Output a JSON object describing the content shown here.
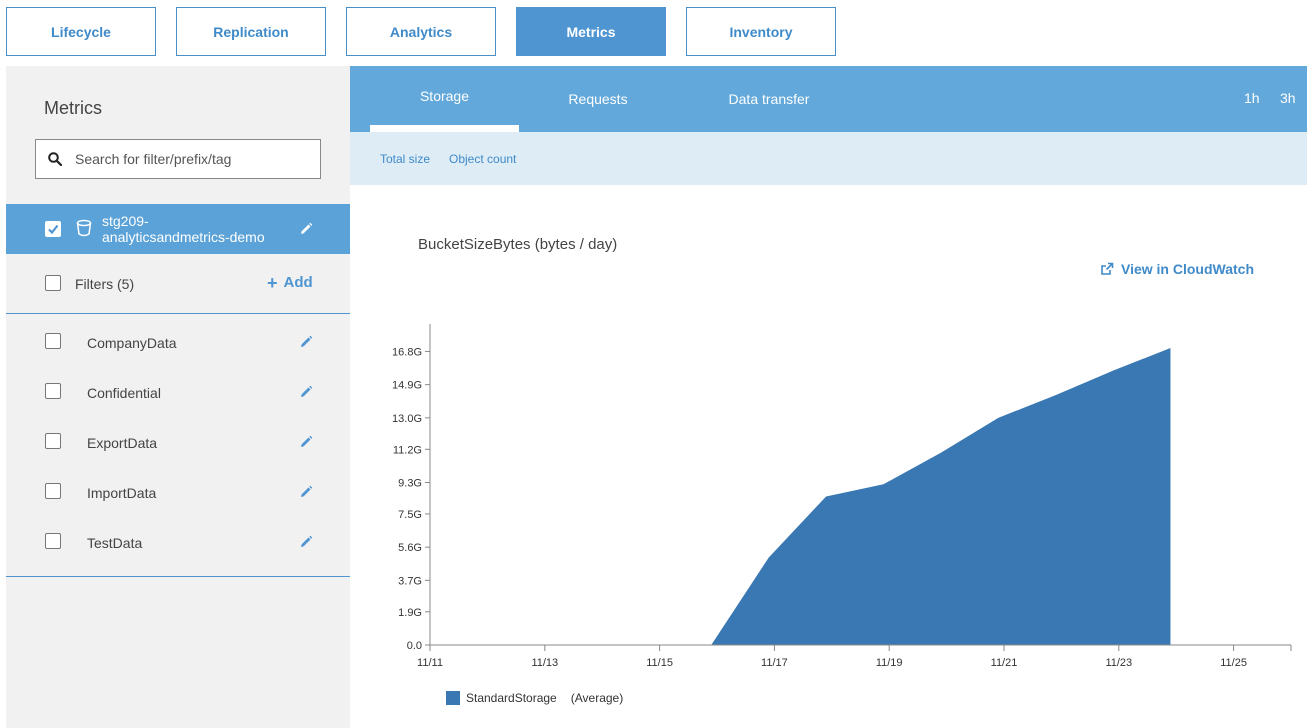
{
  "top_tabs": [
    "Lifecycle",
    "Replication",
    "Analytics",
    "Metrics",
    "Inventory"
  ],
  "sidebar": {
    "title": "Metrics",
    "search_placeholder": "Search for filter/prefix/tag",
    "bucket": {
      "line1": "stg209-",
      "line2": "analyticsandmetrics-demo"
    },
    "filters_label": "Filters (5)",
    "add_label": "Add",
    "filters": [
      "CompanyData",
      "Confidential",
      "ExportData",
      "ImportData",
      "TestData"
    ]
  },
  "main": {
    "tabs": [
      "Storage",
      "Requests",
      "Data transfer"
    ],
    "time_options": [
      "1h",
      "3h"
    ],
    "sub_links": [
      "Total size",
      "Object count"
    ],
    "chart_title": "BucketSizeBytes (bytes / day)",
    "cloudwatch_link": "View in CloudWatch"
  },
  "colors": {
    "accent": "#4e95d2",
    "tab_bar": "#62a8da",
    "series": "#3a78b3"
  },
  "chart_data": {
    "type": "area",
    "title": "BucketSizeBytes (bytes / day)",
    "x": [
      "11/15",
      "11/16",
      "11/17",
      "11/18",
      "11/19",
      "11/20",
      "11/21",
      "11/22",
      "11/23",
      "11/24"
    ],
    "x_days": [
      15.9,
      16.9,
      17.9,
      18.9,
      19.9,
      20.9,
      21.9,
      22.9,
      23.9
    ],
    "series": [
      {
        "name": "StandardStorage",
        "stat": "(Average)",
        "points": [
          [
            15.9,
            0.0
          ],
          [
            16.9,
            5.0
          ],
          [
            17.9,
            8.5
          ],
          [
            18.9,
            9.2
          ],
          [
            19.9,
            11.0
          ],
          [
            20.9,
            13.0
          ],
          [
            21.9,
            14.3
          ],
          [
            22.9,
            15.7
          ],
          [
            23.9,
            17.0
          ]
        ]
      }
    ],
    "x_ticks": [
      "11/11",
      "11/13",
      "11/15",
      "11/17",
      "11/19",
      "11/21",
      "11/23",
      "11/25"
    ],
    "x_tick_days": [
      11,
      13,
      15,
      17,
      19,
      21,
      23,
      25
    ],
    "xlim": [
      11,
      26
    ],
    "y_ticks": [
      "0.0",
      "1.9G",
      "3.7G",
      "5.6G",
      "7.5G",
      "9.3G",
      "11.2G",
      "13.0G",
      "14.9G",
      "16.8G"
    ],
    "ylim": [
      0,
      18.6
    ],
    "y_unit": "G",
    "grid": false,
    "legend": "bottom-left"
  }
}
